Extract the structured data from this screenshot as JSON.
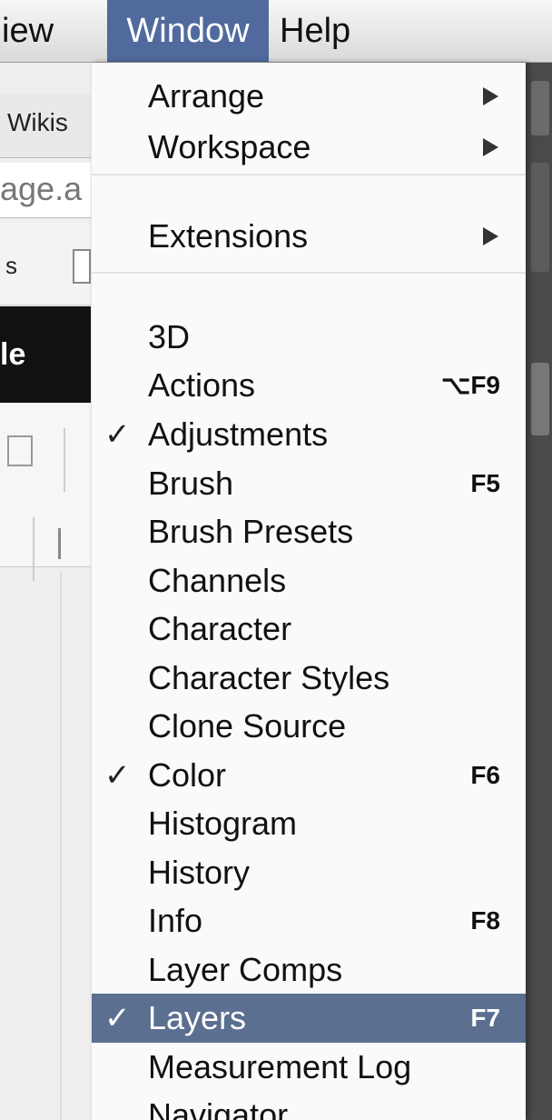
{
  "menubar": {
    "items": [
      {
        "label": "iew"
      },
      {
        "label": "Window"
      },
      {
        "label": "Help"
      }
    ]
  },
  "background": {
    "tab_label": "Wikis",
    "url_fragment": "age.a",
    "bookmark_fragment": "s",
    "dark_bar_fragment": "le"
  },
  "window_menu": {
    "items": [
      {
        "label": "Arrange",
        "submenu": true
      },
      {
        "label": "Workspace",
        "submenu": true
      },
      {
        "label": "Extensions",
        "submenu": true
      },
      {
        "label": "3D"
      },
      {
        "label": "Actions",
        "shortcut": "⌥F9"
      },
      {
        "label": "Adjustments",
        "checked": true
      },
      {
        "label": "Brush",
        "shortcut": "F5"
      },
      {
        "label": "Brush Presets"
      },
      {
        "label": "Channels"
      },
      {
        "label": "Character"
      },
      {
        "label": "Character Styles"
      },
      {
        "label": "Clone Source"
      },
      {
        "label": "Color",
        "checked": true,
        "shortcut": "F6"
      },
      {
        "label": "Histogram"
      },
      {
        "label": "History"
      },
      {
        "label": "Info",
        "shortcut": "F8"
      },
      {
        "label": "Layer Comps"
      },
      {
        "label": "Layers",
        "checked": true,
        "shortcut": "F7",
        "highlighted": true
      },
      {
        "label": "Measurement Log"
      },
      {
        "label": "Navigator"
      }
    ],
    "check_glyph": "✓"
  },
  "colors": {
    "active_menu": "#506a9e",
    "highlight_row": "#5b6f90"
  }
}
